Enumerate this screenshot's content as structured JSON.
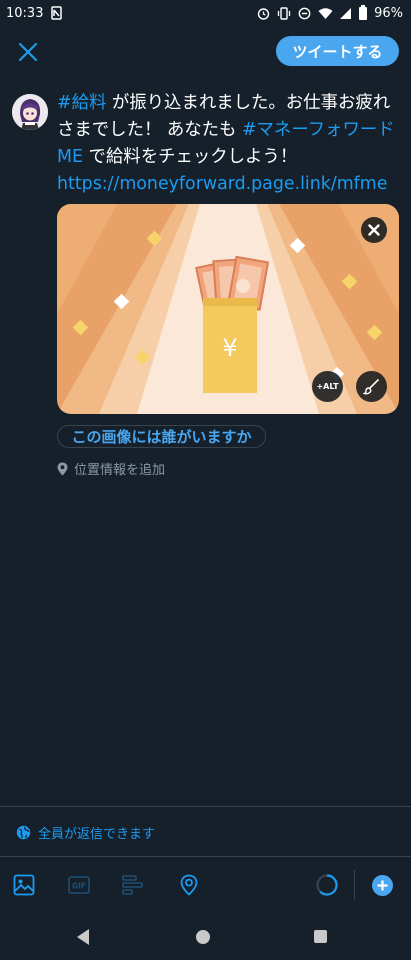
{
  "status_bar": {
    "time": "10:33",
    "battery": "96%"
  },
  "header": {
    "close_icon": "close-icon",
    "tweet_button": "ツイートする"
  },
  "composer": {
    "hashtag_1": "#給料",
    "text_1": " が振り込まれました。お仕事お疲れさまでした！ あなたも ",
    "hashtag_2": "#マネーフォワードME",
    "text_2": " で給料をチェックしよう！",
    "link": "https://moneyforward.page.link/mfme"
  },
  "media": {
    "remove_icon": "close-icon",
    "alt_label": "+ALT",
    "edit_icon": "brush-icon",
    "currency_symbol": "¥"
  },
  "tag_people_label": "この画像には誰がいますか",
  "location_label": "位置情報を追加",
  "reply_setting_label": "全員が返信できます",
  "toolbar": {
    "icons": [
      "image-icon",
      "gif-icon",
      "poll-icon",
      "location-icon"
    ],
    "gif_label": "GIF"
  },
  "colors": {
    "background": "#15202b",
    "accent": "#1d9bf0",
    "button": "#4aa6ef",
    "muted": "#8b98a5",
    "divider": "#38444d"
  }
}
